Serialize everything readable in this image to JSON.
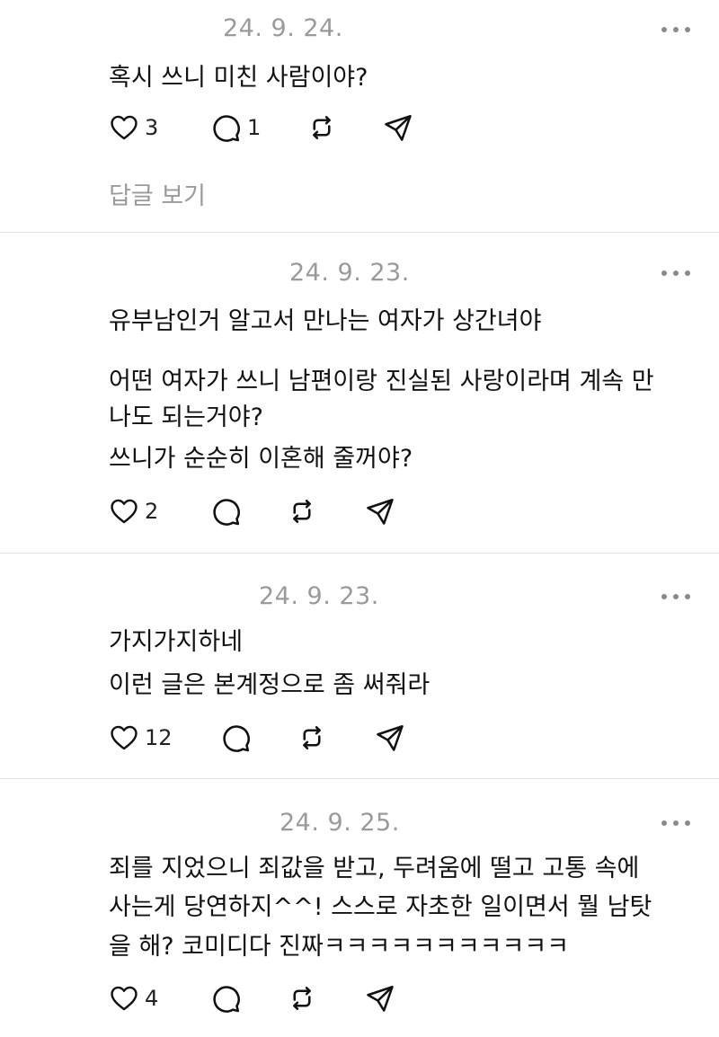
{
  "posts": [
    {
      "date": "24. 9. 24.",
      "lines": [
        "혹시 쓰니 미친 사람이야?"
      ],
      "likes": "3",
      "comments": "1",
      "view_replies": "답글 보기"
    },
    {
      "date": "24. 9. 23.",
      "lines": [
        "유부남인거 알고서 만나는 여자가 상간녀야",
        "어떤 여자가 쓰니 남편이랑 진실된 사랑이라며 계속 만",
        "나도 되는거야?",
        "쓰니가 순순히 이혼해 줄꺼야?"
      ],
      "likes": "2",
      "comments": ""
    },
    {
      "date": "24. 9. 23.",
      "lines": [
        "가지가지하네",
        "이런 글은 본계정으로 좀 써줘라"
      ],
      "likes": "12",
      "comments": ""
    },
    {
      "date": "24. 9. 25.",
      "lines": [
        "죄를 지었으니 죄값을 받고, 두려움에 떨고 고통 속에",
        "사는게 당연하지^^! 스스로 자초한 일이면서 뭘 남탓",
        "을 해? 코미디다 진짜ㅋㅋㅋㅋㅋㅋㅋㅋㅋㅋㅋ"
      ],
      "likes": "4",
      "comments": ""
    }
  ],
  "icons": {
    "like": "heart-icon",
    "comment": "comment-bubble-icon",
    "repost": "repost-icon",
    "share": "send-icon",
    "more": "more-dots-icon"
  },
  "colors": {
    "text": "#111111",
    "muted": "#9a9a9a",
    "divider": "#e2e2e2"
  }
}
